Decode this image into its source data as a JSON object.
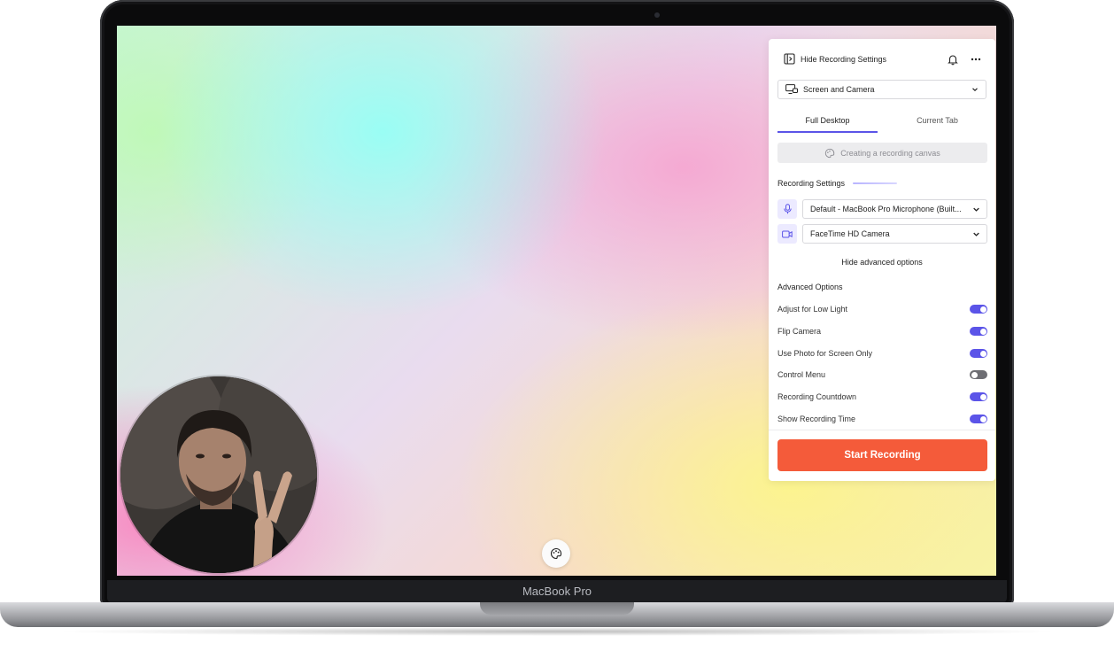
{
  "device": {
    "brand_label": "MacBook Pro"
  },
  "panel": {
    "hide_settings_label": "Hide Recording Settings",
    "capture_mode": "Screen and Camera",
    "tabs": [
      {
        "label": "Full Desktop",
        "active": true
      },
      {
        "label": "Current Tab",
        "active": false
      }
    ],
    "canvas_button_label": "Creating a recording canvas",
    "recording_settings_title": "Recording Settings",
    "microphone": "Default - MacBook Pro Microphone (Built...",
    "camera": "FaceTime HD Camera",
    "hide_advanced_label": "Hide advanced options",
    "advanced_title": "Advanced Options",
    "options": [
      {
        "label": "Adjust for Low Light",
        "on": true
      },
      {
        "label": "Flip Camera",
        "on": true
      },
      {
        "label": "Use Photo for Screen Only",
        "on": true
      },
      {
        "label": "Control Menu",
        "on": false
      },
      {
        "label": "Recording Countdown",
        "on": true
      },
      {
        "label": "Show Recording Time",
        "on": true
      }
    ],
    "start_label": "Start Recording"
  },
  "colors": {
    "accent": "#5b54e8",
    "start_button": "#f45b3a"
  },
  "icons": {
    "sidebar_toggle": "panel-toggle-icon",
    "notifications": "bell-icon",
    "menu": "more-horizontal-icon",
    "mode": "screen-camera-icon",
    "microphone": "microphone-icon",
    "camera": "video-camera-icon",
    "palette": "palette-icon"
  }
}
